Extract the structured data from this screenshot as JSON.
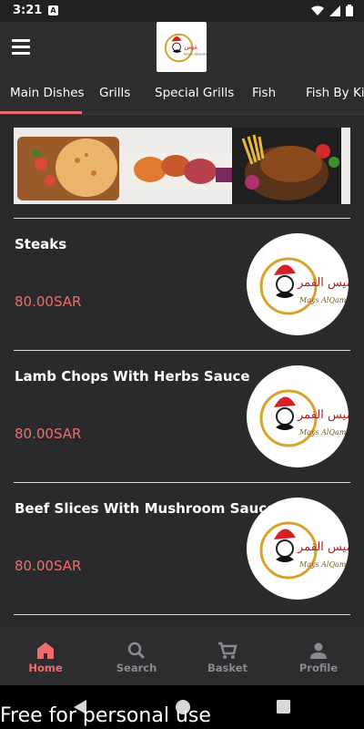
{
  "status_bar": {
    "time": "3:21",
    "notification_letter": "A"
  },
  "header": {
    "menu_icon": "hamburger-icon",
    "logo": "restaurant-logo"
  },
  "tabs": [
    "Main Dishes",
    "Grills",
    "Special Grills",
    "Fish",
    "Fish By Kilo"
  ],
  "active_tab": "Main Dishes",
  "dishes": [
    {
      "name": "Steaks",
      "price": "80.00SAR"
    },
    {
      "name": "Lamb Chops With Herbs Sauce",
      "price": "80.00SAR"
    },
    {
      "name": "Beef Slices With Mushroom Sauce",
      "price": "80.00SAR"
    }
  ],
  "bottom_nav": [
    {
      "label": "Home",
      "icon": "home-icon"
    },
    {
      "label": "Search",
      "icon": "search-icon"
    },
    {
      "label": "Basket",
      "icon": "cart-icon"
    },
    {
      "label": "Profile",
      "icon": "person-icon"
    }
  ],
  "watermark": "Free for personal use",
  "colors": {
    "accent": "#f06b6b",
    "background": "#2a2a2d",
    "inactive": "#8a8a8e"
  }
}
